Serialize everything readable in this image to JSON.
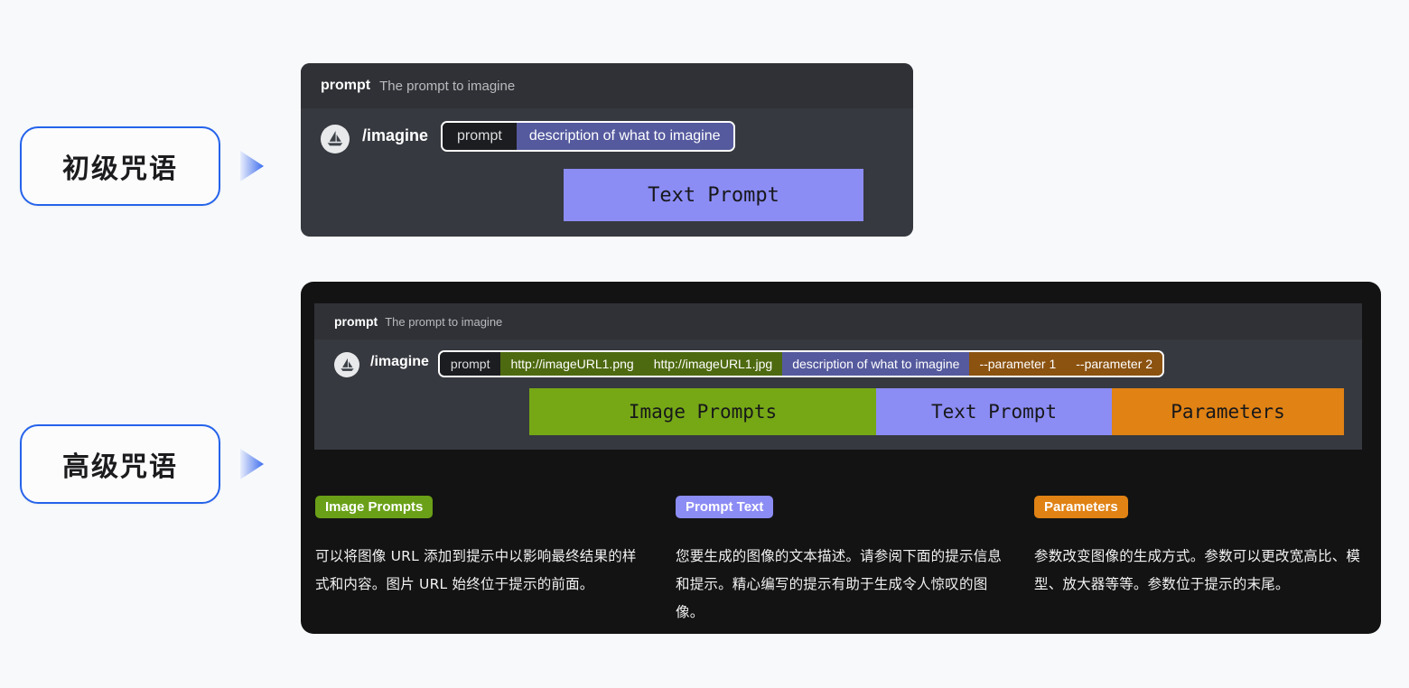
{
  "callouts": [
    {
      "label": "初级咒语"
    },
    {
      "label": "高级咒语"
    }
  ],
  "basic_panel": {
    "header": {
      "key": "prompt",
      "description": "The prompt to imagine"
    },
    "avatar_icon": "midjourney-sailboat-icon",
    "command": "/imagine",
    "tokens": [
      {
        "text": "prompt",
        "style": "key"
      },
      {
        "text": "description of what to imagine",
        "style": "blue"
      }
    ],
    "bands": [
      {
        "text": "Text Prompt",
        "color": "#8c8cf5"
      }
    ]
  },
  "advanced_panel": {
    "header": {
      "key": "prompt",
      "description": "The prompt to imagine"
    },
    "avatar_icon": "midjourney-sailboat-icon",
    "command": "/imagine",
    "tokens": [
      {
        "text": "prompt",
        "style": "key"
      },
      {
        "text": "http://imageURL1.png",
        "style": "green"
      },
      {
        "text": "http://imageURL1.jpg",
        "style": "green"
      },
      {
        "text": "description of what to imagine",
        "style": "blue"
      },
      {
        "text": "--parameter 1",
        "style": "orange"
      },
      {
        "text": "--parameter 2",
        "style": "orange"
      }
    ],
    "bands": [
      {
        "text": "Image Prompts",
        "color": "#76a816"
      },
      {
        "text": "Text Prompt",
        "color": "#8c8cf5"
      },
      {
        "text": "Parameters",
        "color": "#e08214"
      }
    ]
  },
  "legend": [
    {
      "tag": "Image Prompts",
      "tag_color": "#6aa018",
      "body": "可以将图像 URL 添加到提示中以影响最终结果的样式和内容。图片 URL 始终位于提示的前面。"
    },
    {
      "tag": "Prompt Text",
      "tag_color": "#8c8cf5",
      "body": "您要生成的图像的文本描述。请参阅下面的提示信息和提示。精心编写的提示有助于生成令人惊叹的图像。"
    },
    {
      "tag": "Parameters",
      "tag_color": "#e08214",
      "body": "参数改变图像的生成方式。参数可以更改宽高比、模型、放大器等等。参数位于提示的末尾。"
    }
  ],
  "colors": {
    "page_background": "#f7f9fb",
    "accent_blue": "#2563eb",
    "discord_body": "#36393f",
    "discord_header": "#2f3136",
    "card_dark": "#131313",
    "green": "#76a816",
    "blue": "#8c8cf5",
    "orange": "#e08214"
  }
}
